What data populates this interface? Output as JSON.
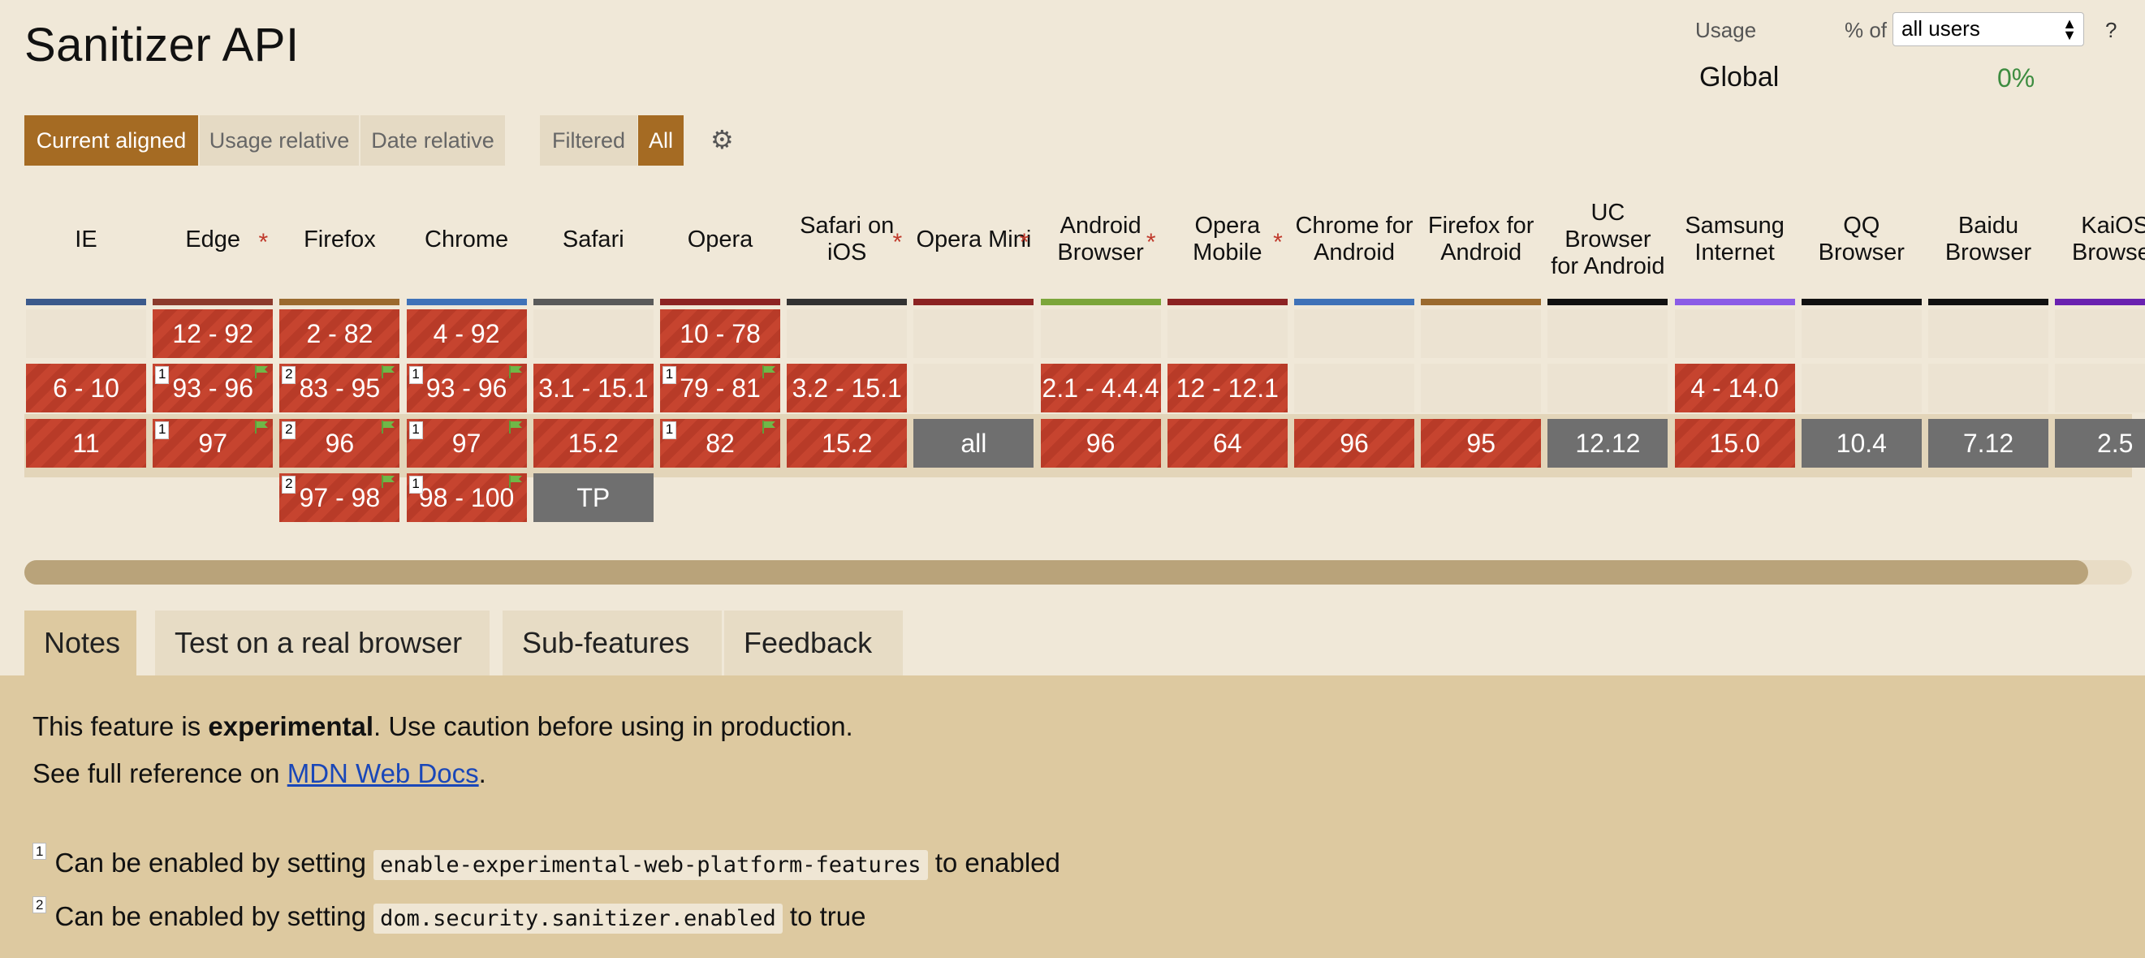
{
  "title": "Sanitizer API",
  "usage": {
    "label": "Usage",
    "pct_of": "% of",
    "select_value": "all users",
    "help": "?",
    "global_label": "Global",
    "global_value": "0%"
  },
  "views": {
    "current_aligned": "Current aligned",
    "usage_relative": "Usage relative",
    "date_relative": "Date relative",
    "filtered": "Filtered",
    "all": "All"
  },
  "browsers": [
    {
      "name": "IE",
      "color": "#3c5a8c",
      "asterisk": false
    },
    {
      "name": "Edge",
      "color": "#8c3a2c",
      "asterisk": true
    },
    {
      "name": "Firefox",
      "color": "#9b6a2e",
      "asterisk": false
    },
    {
      "name": "Chrome",
      "color": "#3f72b8",
      "asterisk": false
    },
    {
      "name": "Safari",
      "color": "#5a5a5a",
      "asterisk": false
    },
    {
      "name": "Opera",
      "color": "#8c2323",
      "asterisk": false
    },
    {
      "name": "Safari on iOS",
      "color": "#333333",
      "asterisk": true
    },
    {
      "name": "Opera Mini",
      "color": "#8c2323",
      "asterisk": true
    },
    {
      "name": "Android Browser",
      "color": "#7ca63b",
      "asterisk": true
    },
    {
      "name": "Opera Mobile",
      "color": "#8c2323",
      "asterisk": true
    },
    {
      "name": "Chrome for Android",
      "color": "#3f72b8",
      "asterisk": false
    },
    {
      "name": "Firefox for Android",
      "color": "#9b6a2e",
      "asterisk": false
    },
    {
      "name": "UC Browser for Android",
      "color": "#111111",
      "asterisk": false
    },
    {
      "name": "Samsung Internet",
      "color": "#8b5ce6",
      "asterisk": false
    },
    {
      "name": "QQ Browser",
      "color": "#111111",
      "asterisk": false
    },
    {
      "name": "Baidu Browser",
      "color": "#111111",
      "asterisk": false
    },
    {
      "name": "KaiOS Browser",
      "color": "#6a22b0",
      "asterisk": false
    }
  ],
  "rows": [
    [
      {
        "t": "empty"
      },
      {
        "t": "red",
        "v": "12 - 92"
      },
      {
        "t": "red",
        "v": "2 - 82"
      },
      {
        "t": "red",
        "v": "4 - 92"
      },
      {
        "t": "empty"
      },
      {
        "t": "red",
        "v": "10 - 78"
      },
      {
        "t": "empty"
      },
      {
        "t": "empty"
      },
      {
        "t": "empty"
      },
      {
        "t": "empty"
      },
      {
        "t": "empty"
      },
      {
        "t": "empty"
      },
      {
        "t": "empty"
      },
      {
        "t": "empty"
      },
      {
        "t": "empty"
      },
      {
        "t": "empty"
      },
      {
        "t": "empty"
      }
    ],
    [
      {
        "t": "red",
        "v": "6 - 10"
      },
      {
        "t": "red",
        "v": "93 - 96",
        "n": "1",
        "f": true
      },
      {
        "t": "red",
        "v": "83 - 95",
        "n": "2",
        "f": true
      },
      {
        "t": "red",
        "v": "93 - 96",
        "n": "1",
        "f": true
      },
      {
        "t": "red",
        "v": "3.1 - 15.1"
      },
      {
        "t": "red",
        "v": "79 - 81",
        "n": "1",
        "f": true
      },
      {
        "t": "red",
        "v": "3.2 - 15.1"
      },
      {
        "t": "empty"
      },
      {
        "t": "red",
        "v": "2.1 - 4.4.4"
      },
      {
        "t": "red",
        "v": "12 - 12.1"
      },
      {
        "t": "empty"
      },
      {
        "t": "empty"
      },
      {
        "t": "empty"
      },
      {
        "t": "red",
        "v": "4 - 14.0"
      },
      {
        "t": "empty"
      },
      {
        "t": "empty"
      },
      {
        "t": "empty"
      }
    ],
    [
      {
        "t": "red",
        "v": "11"
      },
      {
        "t": "red",
        "v": "97",
        "n": "1",
        "f": true
      },
      {
        "t": "red",
        "v": "96",
        "n": "2",
        "f": true
      },
      {
        "t": "red",
        "v": "97",
        "n": "1",
        "f": true
      },
      {
        "t": "red",
        "v": "15.2"
      },
      {
        "t": "red",
        "v": "82",
        "n": "1",
        "f": true
      },
      {
        "t": "red",
        "v": "15.2"
      },
      {
        "t": "gray",
        "v": "all"
      },
      {
        "t": "red",
        "v": "96"
      },
      {
        "t": "red",
        "v": "64"
      },
      {
        "t": "red",
        "v": "96"
      },
      {
        "t": "red",
        "v": "95"
      },
      {
        "t": "gray",
        "v": "12.12"
      },
      {
        "t": "red",
        "v": "15.0"
      },
      {
        "t": "gray",
        "v": "10.4"
      },
      {
        "t": "gray",
        "v": "7.12"
      },
      {
        "t": "gray",
        "v": "2.5"
      }
    ],
    [
      {
        "t": "none"
      },
      {
        "t": "none"
      },
      {
        "t": "red",
        "v": "97 - 98",
        "n": "2",
        "f": true
      },
      {
        "t": "red",
        "v": "98 - 100",
        "n": "1",
        "f": true
      },
      {
        "t": "gray",
        "v": "TP"
      },
      {
        "t": "none"
      },
      {
        "t": "none"
      },
      {
        "t": "none"
      },
      {
        "t": "none"
      },
      {
        "t": "none"
      },
      {
        "t": "none"
      },
      {
        "t": "none"
      },
      {
        "t": "none"
      },
      {
        "t": "none"
      },
      {
        "t": "none"
      },
      {
        "t": "none"
      },
      {
        "t": "none"
      }
    ]
  ],
  "tabs": [
    "Notes",
    "Test on a real browser",
    "Sub-features",
    "Feedback"
  ],
  "notes": {
    "line1_pre": "This feature is ",
    "line1_bold": "experimental",
    "line1_post": ". Use caution before using in production.",
    "line2_pre": "See full reference on ",
    "line2_link": "MDN Web Docs",
    "line2_post": ".",
    "fn1_num": "1",
    "fn1_pre": "Can be enabled by setting ",
    "fn1_code": "enable-experimental-web-platform-features",
    "fn1_post": " to enabled",
    "fn2_num": "2",
    "fn2_pre": "Can be enabled by setting ",
    "fn2_code": "dom.security.sanitizer.enabled",
    "fn2_post": " to true"
  }
}
